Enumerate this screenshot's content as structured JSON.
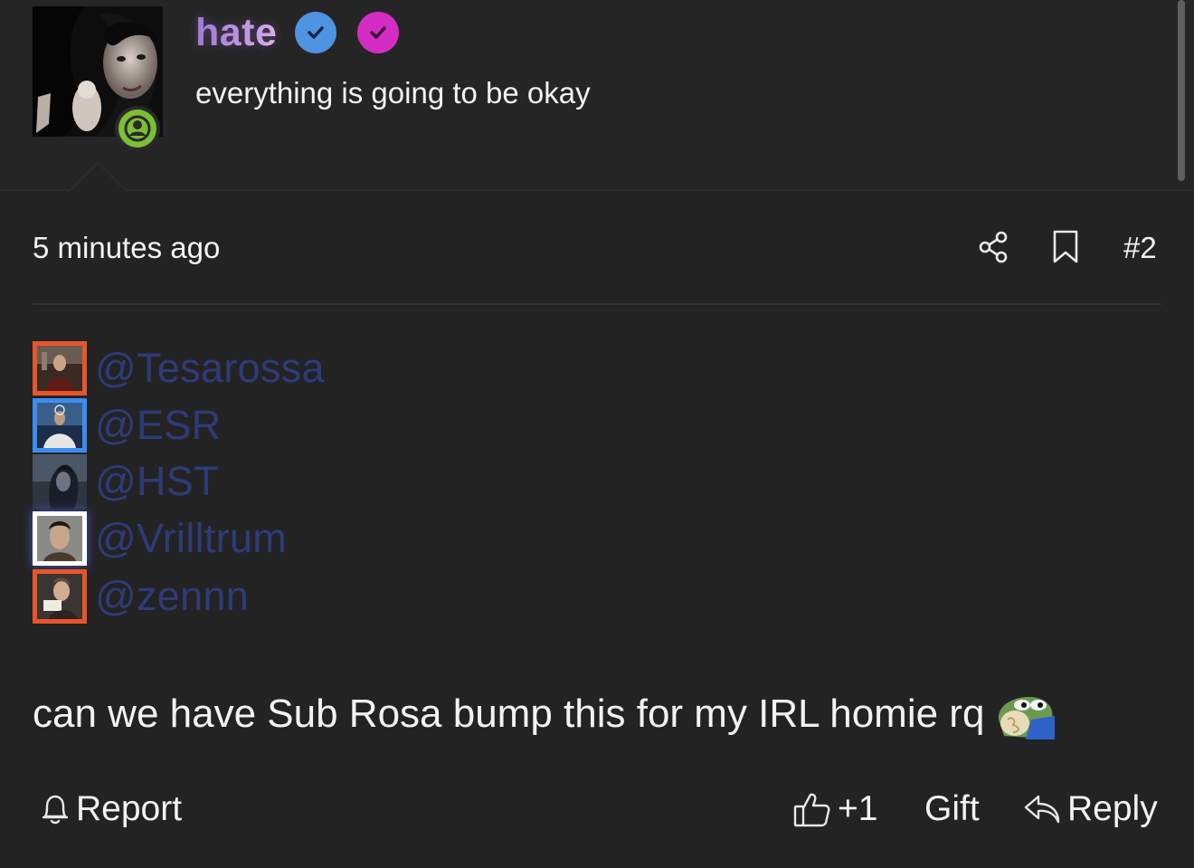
{
  "author": {
    "username": "hate",
    "tagline": "everything is going to be okay",
    "badges": [
      "blue-verified-check-icon",
      "pink-verified-check-icon"
    ],
    "status": "online-user-icon"
  },
  "post": {
    "timestamp": "5 minutes ago",
    "post_number": "#2",
    "mentions": [
      {
        "handle": "@Tesarossa",
        "frame_color": "#e8552a"
      },
      {
        "handle": "@ESR",
        "frame_color": "#3d8cf0"
      },
      {
        "handle": "@HST",
        "frame_color": "none"
      },
      {
        "handle": "@Vrilltrum",
        "frame_color": "#ffffff"
      },
      {
        "handle": "@zennn",
        "frame_color": "#e8552a"
      }
    ],
    "text": "can we have Sub Rosa bump this for my IRL homie rq",
    "emoji": "pepe-emoji"
  },
  "actions": {
    "report_label": "Report",
    "like_count": "+1",
    "gift_label": "Gift",
    "reply_label": "Reply"
  },
  "colors": {
    "background": "#232324",
    "mention_text": "#2f3b78",
    "online_green": "#7dbf34",
    "verified_blue": "#4f93e3",
    "verified_pink": "#d52dc3",
    "username_gradient": [
      "#9a7ad6",
      "#e3b5e8"
    ]
  }
}
